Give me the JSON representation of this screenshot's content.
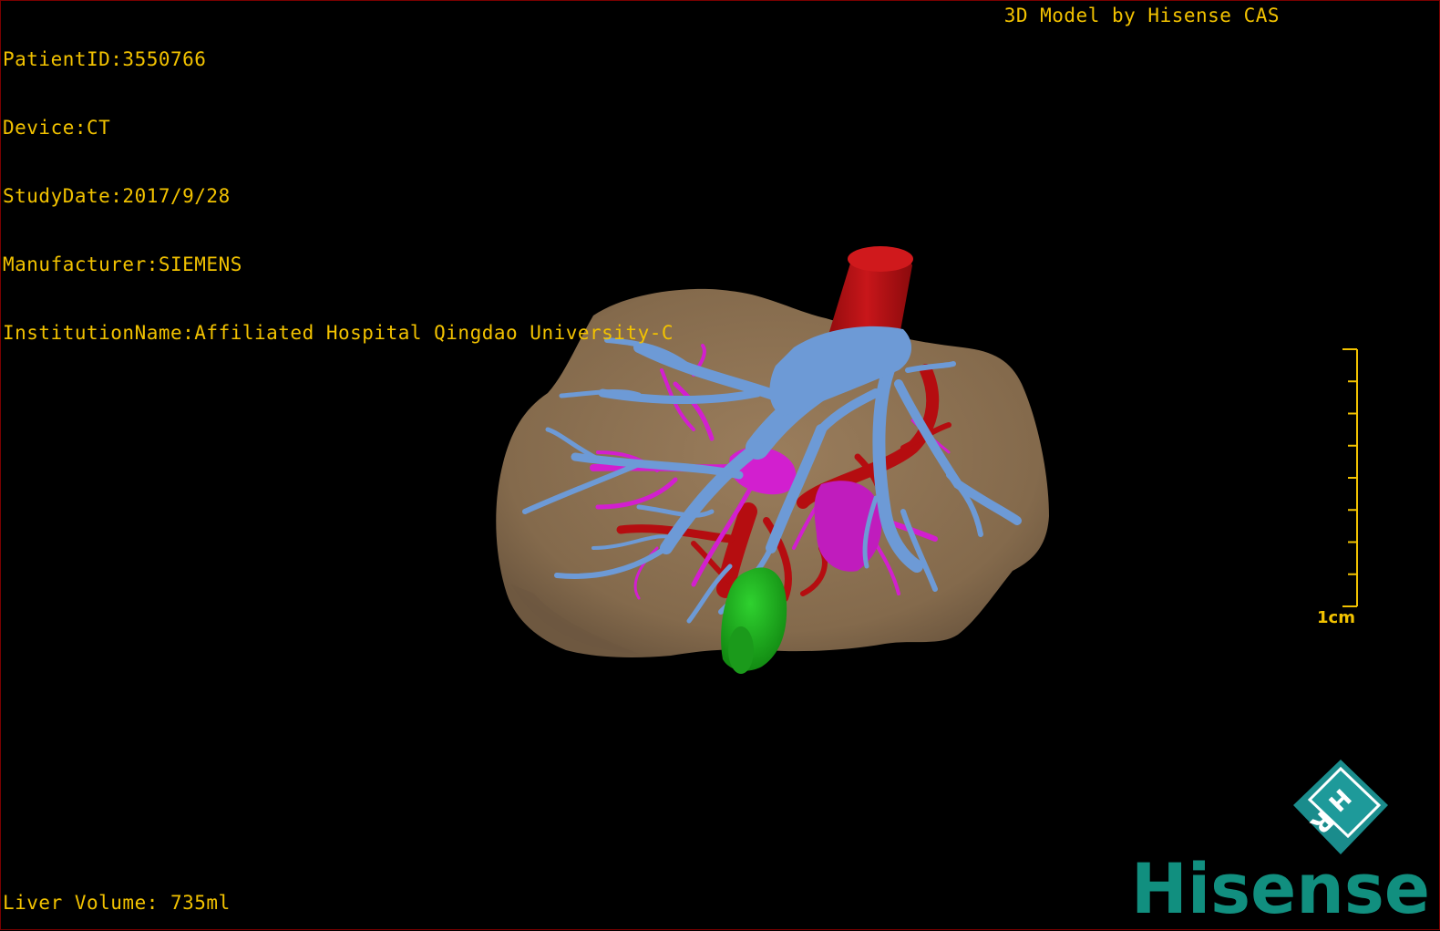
{
  "patient": {
    "id_line": "PatientID:3550766",
    "device_line": "Device:CT",
    "date_line": "StudyDate:2017/9/28",
    "manufacturer_line": "Manufacturer:SIEMENS",
    "institution_line": "InstitutionName:Affiliated Hospital Qingdao University-C"
  },
  "model_label": "3D Model by Hisense CAS",
  "volume_line": "Liver Volume: 735ml",
  "scale": {
    "label": "1cm",
    "ticks": 9
  },
  "orientation_cube": {
    "letters": [
      "H",
      "R"
    ],
    "color": "#1a8c8c"
  },
  "brand": {
    "text": "Hisense",
    "color": "#118f7f"
  },
  "colors": {
    "overlay_text": "#f2c200",
    "liver": "#8a6e4f",
    "portal_vein": "#6d9ad6",
    "hepatic_vein": "#d21fcf",
    "artery": "#b50d10",
    "gallbladder": "#1faa1f",
    "border": "#7a0000"
  },
  "structures": [
    {
      "name": "liver",
      "icon": "liver-surface"
    },
    {
      "name": "portal-vein",
      "icon": "vessel-tree"
    },
    {
      "name": "hepatic-vein",
      "icon": "vessel-tree"
    },
    {
      "name": "artery",
      "icon": "vessel"
    },
    {
      "name": "gallbladder",
      "icon": "organ"
    }
  ]
}
